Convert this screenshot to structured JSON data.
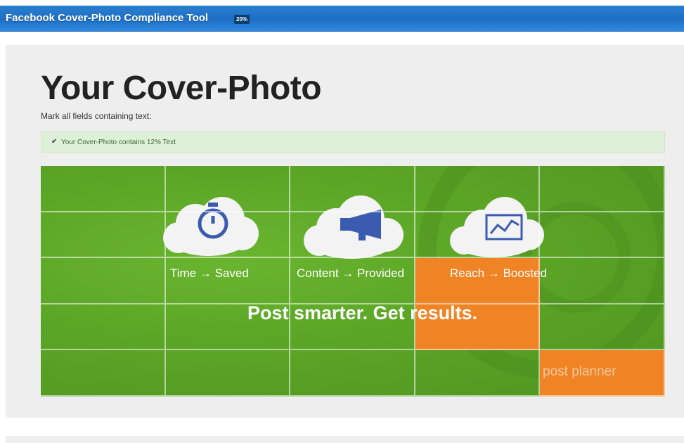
{
  "header": {
    "title": "Facebook Cover-Photo Compliance Tool",
    "badge": "20%"
  },
  "main": {
    "title": "Your Cover-Photo",
    "instruction": "Mark all fields containing text:",
    "alert": {
      "icon": "checkmark-icon",
      "text": "Your Cover-Photo contains 12% Text"
    }
  },
  "cover": {
    "captions": [
      "Time → Saved",
      "Content → Provided",
      "Reach → Boosted"
    ],
    "tagline": "Post smarter. Get results.",
    "brand": "post planner",
    "icons": [
      "stopwatch-icon",
      "megaphone-icon",
      "chart-icon"
    ],
    "grid": {
      "cols": 5,
      "rows": 5,
      "marked_cells": [
        [
          2,
          3
        ],
        [
          3,
          3
        ],
        [
          4,
          4
        ]
      ]
    }
  },
  "colors": {
    "header_blue": "#1e6ec3",
    "marked_orange": "#f08324",
    "cover_green": "#5ba526",
    "alert_green": "#dff0d8"
  }
}
